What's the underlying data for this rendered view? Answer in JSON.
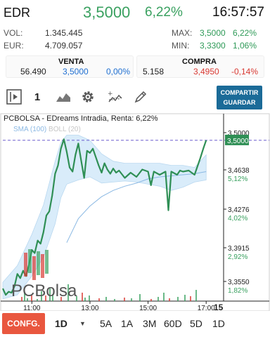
{
  "header": {
    "symbol": "EDR",
    "price": "3,5000",
    "change_pct": "6,22%",
    "time": "16:57:57"
  },
  "stats": {
    "vol_label": "VOL:",
    "vol_value": "1.345.445",
    "eur_label": "EUR:",
    "eur_value": "4.709.057",
    "max_label": "MAX:",
    "max_value": "3,5000",
    "max_pct": "6,22%",
    "min_label": "MIN:",
    "min_value": "3,3300",
    "min_pct": "1,06%"
  },
  "orderbook": {
    "venta": {
      "label": "VENTA",
      "qty": "56.490",
      "price": "3,5000",
      "pct": "0,00%"
    },
    "compra": {
      "label": "COMPRA",
      "qty": "5.158",
      "price": "3,4950",
      "pct": "-0,14%"
    }
  },
  "toolbar": {
    "count": "1",
    "share_line1": "COMPARTIR",
    "share_line2": "GUARDAR",
    "icons": [
      "play-toggle-icon",
      "mountain-chart-icon",
      "gear-icon",
      "indicator-icon",
      "pencil-icon"
    ]
  },
  "chart": {
    "title": "PCBOLSA - EDreams Intradia, Renta: 6,22%",
    "legend_sma": "SMA (100)",
    "legend_boll": "BOLL (20)",
    "watermark": "PCBolsa"
  },
  "chart_data": {
    "type": "line",
    "title": "PCBOLSA - EDreams Intradia, Renta: 6,22%",
    "x_tick_labels": [
      "11:00",
      "13:00",
      "15:00",
      "17:00"
    ],
    "x_extra_label": "15",
    "y_tick_labels": [
      {
        "price": "3,5000",
        "pct": ""
      },
      {
        "price": "3,4638",
        "pct": "5,12%"
      },
      {
        "price": "3,4276",
        "pct": "4,02%"
      },
      {
        "price": "3,3915",
        "pct": "2,92%"
      },
      {
        "price": "3,3550",
        "pct": "1,82%"
      }
    ],
    "ylim": [
      3.348,
      3.508
    ],
    "xlim": [
      10.0,
      17.6
    ],
    "reference_line": 3.5,
    "price": {
      "x": [
        10.0,
        10.1,
        10.2,
        10.3,
        10.4,
        10.5,
        10.6,
        10.7,
        10.8,
        10.9,
        11.0,
        11.1,
        11.2,
        11.3,
        11.4,
        11.5,
        11.6,
        11.7,
        11.8,
        11.9,
        12.0,
        12.1,
        12.2,
        12.3,
        12.4,
        12.5,
        12.6,
        12.7,
        12.8,
        12.9,
        13.0,
        13.1,
        13.2,
        13.3,
        13.4,
        13.5,
        13.6,
        13.7,
        13.8,
        13.9,
        14.0,
        14.2,
        14.4,
        14.6,
        14.8,
        15.0,
        15.1,
        15.2,
        15.4,
        15.6,
        15.7,
        15.8,
        16.0,
        16.1,
        16.2,
        16.4,
        16.6,
        16.7,
        16.8,
        16.9,
        17.0
      ],
      "y": [
        3.358,
        3.352,
        3.355,
        3.354,
        3.36,
        3.372,
        3.368,
        3.375,
        3.37,
        3.381,
        3.395,
        3.392,
        3.404,
        3.401,
        3.412,
        3.428,
        3.432,
        3.447,
        3.468,
        3.476,
        3.492,
        3.501,
        3.489,
        3.474,
        3.47,
        3.486,
        3.497,
        3.48,
        3.464,
        3.49,
        3.488,
        3.492,
        3.484,
        3.476,
        3.469,
        3.478,
        3.472,
        3.468,
        3.473,
        3.469,
        3.471,
        3.464,
        3.469,
        3.465,
        3.472,
        3.47,
        3.457,
        3.47,
        3.467,
        3.47,
        3.433,
        3.47,
        3.467,
        3.471,
        3.47,
        3.471,
        3.467,
        3.475,
        3.483,
        3.492,
        3.5
      ]
    },
    "sma_100": {
      "x": [
        12.2,
        12.6,
        13.0,
        13.4,
        13.8,
        14.2,
        14.6,
        15.0,
        15.4,
        15.8,
        16.2,
        16.6,
        17.0
      ],
      "y": [
        3.402,
        3.425,
        3.437,
        3.446,
        3.452,
        3.456,
        3.459,
        3.463,
        3.465,
        3.466,
        3.467,
        3.468,
        3.47
      ]
    },
    "boll_upper": {
      "x": [
        10.0,
        10.5,
        11.0,
        11.4,
        11.8,
        12.0,
        12.2,
        12.6,
        13.0,
        13.4,
        13.8,
        14.2,
        14.6,
        15.0,
        15.4,
        15.8,
        16.2,
        16.6,
        17.0
      ],
      "y": [
        3.364,
        3.38,
        3.41,
        3.438,
        3.48,
        3.498,
        3.505,
        3.505,
        3.5,
        3.487,
        3.48,
        3.478,
        3.478,
        3.478,
        3.478,
        3.476,
        3.476,
        3.474,
        3.486
      ]
    },
    "boll_lower": {
      "x": [
        10.0,
        10.5,
        11.0,
        11.4,
        11.8,
        12.0,
        12.2,
        12.6,
        13.0,
        13.4,
        13.8,
        14.2,
        14.6,
        15.0,
        15.4,
        15.8,
        16.2,
        16.6,
        17.0
      ],
      "y": [
        3.348,
        3.352,
        3.37,
        3.388,
        3.42,
        3.445,
        3.458,
        3.462,
        3.465,
        3.459,
        3.46,
        3.461,
        3.46,
        3.458,
        3.456,
        3.452,
        3.455,
        3.46,
        3.462
      ]
    }
  },
  "footer": {
    "config_label": "CONFG.",
    "selected_period": "1D",
    "dropdown_arrow": "▼",
    "periods": [
      "5A",
      "1A",
      "3M",
      "60D",
      "5D",
      "1D"
    ]
  },
  "colors": {
    "green": "#3aa160",
    "blue": "#1f6fd1",
    "red": "#d93a33",
    "share_button": "#1b6b98",
    "config_button": "#e9573f",
    "price_line": "#2f8f55",
    "boll_fill": "#d9ecfa",
    "sma_line": "#8ab8e3"
  }
}
